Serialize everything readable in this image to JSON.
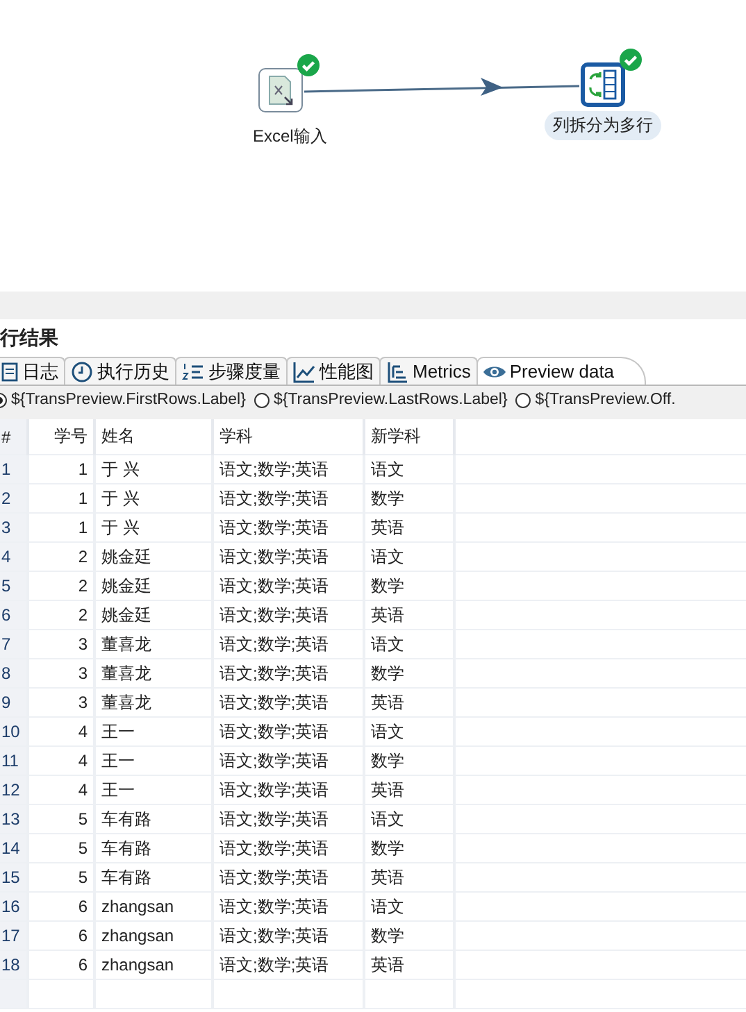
{
  "canvas": {
    "nodes": [
      {
        "label": "Excel输入",
        "succeeded": true,
        "selected": false
      },
      {
        "label": "列拆分为多行",
        "succeeded": true,
        "selected": true
      }
    ]
  },
  "panel": {
    "title": "行结果",
    "tabs": [
      {
        "label": "日志",
        "selected": false
      },
      {
        "label": "执行历史",
        "selected": false
      },
      {
        "label": "步骤度量",
        "selected": false
      },
      {
        "label": "性能图",
        "selected": false
      },
      {
        "label": "Metrics",
        "selected": false
      },
      {
        "label": "Preview data",
        "selected": true
      }
    ],
    "options": [
      {
        "label": "${TransPreview.FirstRows.Label}",
        "selected": true
      },
      {
        "label": "${TransPreview.LastRows.Label}",
        "selected": false
      },
      {
        "label": "${TransPreview.Off.",
        "selected": false
      }
    ],
    "table": {
      "columns": [
        "#",
        "学号",
        "姓名",
        "学科",
        "新学科"
      ],
      "rows": [
        [
          "1",
          "1",
          "于 兴",
          "语文;数学;英语",
          "语文"
        ],
        [
          "2",
          "1",
          "于 兴",
          "语文;数学;英语",
          "数学"
        ],
        [
          "3",
          "1",
          "于 兴",
          "语文;数学;英语",
          "英语"
        ],
        [
          "4",
          "2",
          "姚金廷",
          "语文;数学;英语",
          "语文"
        ],
        [
          "5",
          "2",
          "姚金廷",
          "语文;数学;英语",
          "数学"
        ],
        [
          "6",
          "2",
          "姚金廷",
          "语文;数学;英语",
          "英语"
        ],
        [
          "7",
          "3",
          "董喜龙",
          "语文;数学;英语",
          "语文"
        ],
        [
          "8",
          "3",
          "董喜龙",
          "语文;数学;英语",
          "数学"
        ],
        [
          "9",
          "3",
          "董喜龙",
          "语文;数学;英语",
          "英语"
        ],
        [
          "10",
          "4",
          "王一",
          "语文;数学;英语",
          "语文"
        ],
        [
          "11",
          "4",
          "王一",
          "语文;数学;英语",
          "数学"
        ],
        [
          "12",
          "4",
          "王一",
          "语文;数学;英语",
          "英语"
        ],
        [
          "13",
          "5",
          "车有路",
          "语文;数学;英语",
          "语文"
        ],
        [
          "14",
          "5",
          "车有路",
          "语文;数学;英语",
          "数学"
        ],
        [
          "15",
          "5",
          "车有路",
          "语文;数学;英语",
          "英语"
        ],
        [
          "16",
          "6",
          "zhangsan",
          "语文;数学;英语",
          "语文"
        ],
        [
          "17",
          "6",
          "zhangsan",
          "语文;数学;英语",
          "数学"
        ],
        [
          "18",
          "6",
          "zhangsan",
          "语文;数学;英语",
          "英语"
        ]
      ]
    }
  }
}
